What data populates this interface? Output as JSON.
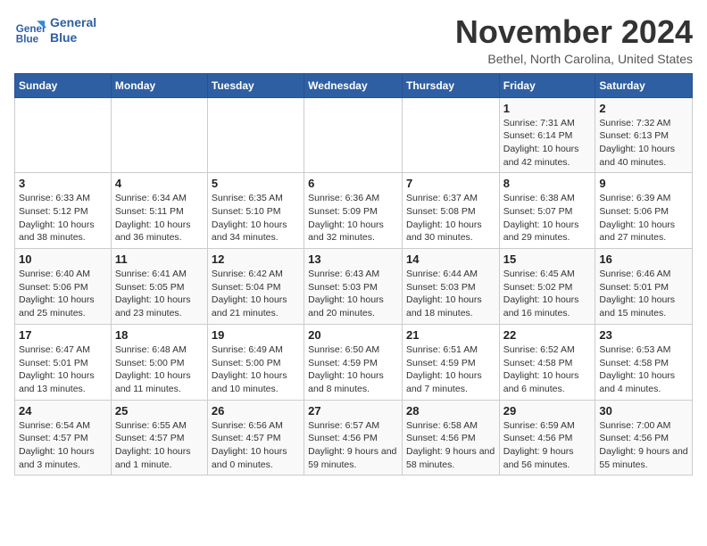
{
  "logo": {
    "text_line1": "General",
    "text_line2": "Blue"
  },
  "title": "November 2024",
  "subtitle": "Bethel, North Carolina, United States",
  "days_of_week": [
    "Sunday",
    "Monday",
    "Tuesday",
    "Wednesday",
    "Thursday",
    "Friday",
    "Saturday"
  ],
  "weeks": [
    [
      {
        "day": "",
        "info": ""
      },
      {
        "day": "",
        "info": ""
      },
      {
        "day": "",
        "info": ""
      },
      {
        "day": "",
        "info": ""
      },
      {
        "day": "",
        "info": ""
      },
      {
        "day": "1",
        "info": "Sunrise: 7:31 AM\nSunset: 6:14 PM\nDaylight: 10 hours and 42 minutes."
      },
      {
        "day": "2",
        "info": "Sunrise: 7:32 AM\nSunset: 6:13 PM\nDaylight: 10 hours and 40 minutes."
      }
    ],
    [
      {
        "day": "3",
        "info": "Sunrise: 6:33 AM\nSunset: 5:12 PM\nDaylight: 10 hours and 38 minutes."
      },
      {
        "day": "4",
        "info": "Sunrise: 6:34 AM\nSunset: 5:11 PM\nDaylight: 10 hours and 36 minutes."
      },
      {
        "day": "5",
        "info": "Sunrise: 6:35 AM\nSunset: 5:10 PM\nDaylight: 10 hours and 34 minutes."
      },
      {
        "day": "6",
        "info": "Sunrise: 6:36 AM\nSunset: 5:09 PM\nDaylight: 10 hours and 32 minutes."
      },
      {
        "day": "7",
        "info": "Sunrise: 6:37 AM\nSunset: 5:08 PM\nDaylight: 10 hours and 30 minutes."
      },
      {
        "day": "8",
        "info": "Sunrise: 6:38 AM\nSunset: 5:07 PM\nDaylight: 10 hours and 29 minutes."
      },
      {
        "day": "9",
        "info": "Sunrise: 6:39 AM\nSunset: 5:06 PM\nDaylight: 10 hours and 27 minutes."
      }
    ],
    [
      {
        "day": "10",
        "info": "Sunrise: 6:40 AM\nSunset: 5:06 PM\nDaylight: 10 hours and 25 minutes."
      },
      {
        "day": "11",
        "info": "Sunrise: 6:41 AM\nSunset: 5:05 PM\nDaylight: 10 hours and 23 minutes."
      },
      {
        "day": "12",
        "info": "Sunrise: 6:42 AM\nSunset: 5:04 PM\nDaylight: 10 hours and 21 minutes."
      },
      {
        "day": "13",
        "info": "Sunrise: 6:43 AM\nSunset: 5:03 PM\nDaylight: 10 hours and 20 minutes."
      },
      {
        "day": "14",
        "info": "Sunrise: 6:44 AM\nSunset: 5:03 PM\nDaylight: 10 hours and 18 minutes."
      },
      {
        "day": "15",
        "info": "Sunrise: 6:45 AM\nSunset: 5:02 PM\nDaylight: 10 hours and 16 minutes."
      },
      {
        "day": "16",
        "info": "Sunrise: 6:46 AM\nSunset: 5:01 PM\nDaylight: 10 hours and 15 minutes."
      }
    ],
    [
      {
        "day": "17",
        "info": "Sunrise: 6:47 AM\nSunset: 5:01 PM\nDaylight: 10 hours and 13 minutes."
      },
      {
        "day": "18",
        "info": "Sunrise: 6:48 AM\nSunset: 5:00 PM\nDaylight: 10 hours and 11 minutes."
      },
      {
        "day": "19",
        "info": "Sunrise: 6:49 AM\nSunset: 5:00 PM\nDaylight: 10 hours and 10 minutes."
      },
      {
        "day": "20",
        "info": "Sunrise: 6:50 AM\nSunset: 4:59 PM\nDaylight: 10 hours and 8 minutes."
      },
      {
        "day": "21",
        "info": "Sunrise: 6:51 AM\nSunset: 4:59 PM\nDaylight: 10 hours and 7 minutes."
      },
      {
        "day": "22",
        "info": "Sunrise: 6:52 AM\nSunset: 4:58 PM\nDaylight: 10 hours and 6 minutes."
      },
      {
        "day": "23",
        "info": "Sunrise: 6:53 AM\nSunset: 4:58 PM\nDaylight: 10 hours and 4 minutes."
      }
    ],
    [
      {
        "day": "24",
        "info": "Sunrise: 6:54 AM\nSunset: 4:57 PM\nDaylight: 10 hours and 3 minutes."
      },
      {
        "day": "25",
        "info": "Sunrise: 6:55 AM\nSunset: 4:57 PM\nDaylight: 10 hours and 1 minute."
      },
      {
        "day": "26",
        "info": "Sunrise: 6:56 AM\nSunset: 4:57 PM\nDaylight: 10 hours and 0 minutes."
      },
      {
        "day": "27",
        "info": "Sunrise: 6:57 AM\nSunset: 4:56 PM\nDaylight: 9 hours and 59 minutes."
      },
      {
        "day": "28",
        "info": "Sunrise: 6:58 AM\nSunset: 4:56 PM\nDaylight: 9 hours and 58 minutes."
      },
      {
        "day": "29",
        "info": "Sunrise: 6:59 AM\nSunset: 4:56 PM\nDaylight: 9 hours and 56 minutes."
      },
      {
        "day": "30",
        "info": "Sunrise: 7:00 AM\nSunset: 4:56 PM\nDaylight: 9 hours and 55 minutes."
      }
    ]
  ],
  "colors": {
    "header_bg": "#2e5fa3",
    "header_text": "#ffffff",
    "accent": "#2e5fa3"
  }
}
